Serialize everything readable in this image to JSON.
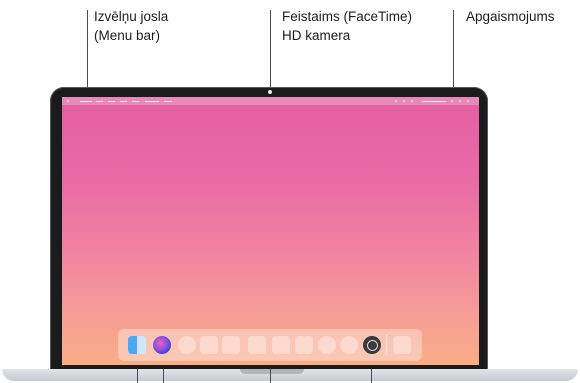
{
  "callouts": {
    "menu_bar": {
      "line1": "Izvēlņu josla",
      "line2": "(Menu bar)"
    },
    "camera": {
      "line1": "Feistaims (FaceTime)",
      "line2": "HD kamera"
    },
    "brightness": {
      "line1": "Apgaismojums"
    }
  },
  "screen": {
    "wallpaper_colors": [
      "#e25fa3",
      "#f080a2",
      "#f9ae86"
    ],
    "dock_icons": [
      "finder-icon",
      "siri-icon",
      "app-placeholder",
      "app-placeholder",
      "app-placeholder",
      "app-placeholder",
      "app-placeholder",
      "app-placeholder",
      "app-placeholder",
      "app-placeholder",
      "system-preferences-icon",
      "folder-placeholder"
    ]
  }
}
